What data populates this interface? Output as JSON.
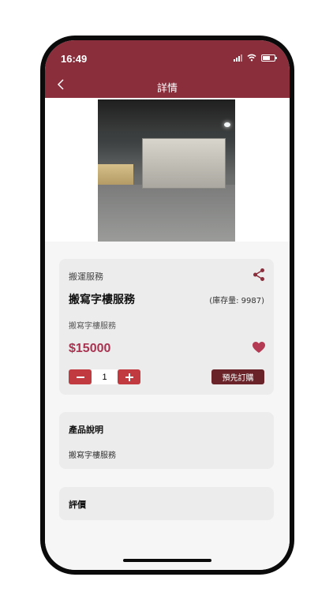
{
  "status_bar": {
    "time": "16:49"
  },
  "header": {
    "title": "詳情"
  },
  "product": {
    "category": "搬運服務",
    "name": "搬寫字樓服務",
    "stock": "(庫存量: 9987)",
    "subtitle": "搬寫字樓服務",
    "price": "$15000",
    "quantity": "1",
    "preorder_label": "預先訂購"
  },
  "description": {
    "title": "產品說明",
    "body": "搬寫字樓服務"
  },
  "reviews": {
    "title": "評價"
  },
  "icons": {
    "back": "chevron-left-icon",
    "share": "share-icon",
    "favorite": "heart-icon",
    "decrease": "minus-icon",
    "increase": "plus-icon"
  },
  "colors": {
    "header": "#8a2e3c",
    "price": "#a93350",
    "stepper": "#c03a3f",
    "preorder": "#6a2429"
  }
}
